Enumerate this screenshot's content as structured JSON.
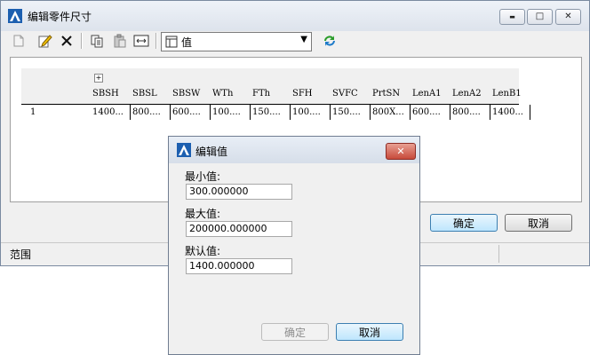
{
  "window": {
    "title": "编辑零件尺寸",
    "minimize_glyph": "▬",
    "maximize_glyph": "□",
    "close_glyph": "✕"
  },
  "toolbar": {
    "combo_value": "值"
  },
  "grid": {
    "expander": "+",
    "columns": [
      "SBSH",
      "SBSL",
      "SBSW",
      "WTh",
      "FTh",
      "SFH",
      "SVFC",
      "PrtSN",
      "LenA1",
      "LenA2",
      "LenB1"
    ],
    "rows": [
      {
        "index": "1",
        "cells": [
          "1400...",
          "800....",
          "600....",
          "100....",
          "150....",
          "100....",
          "150....",
          "800X...",
          "600....",
          "800....",
          "1400..."
        ]
      }
    ]
  },
  "buttons": {
    "ok": "确定",
    "cancel": "取消"
  },
  "status": {
    "text": "范围"
  },
  "dialog": {
    "title": "编辑值",
    "close_glyph": "✕",
    "min_label": "最小值:",
    "min_value": "300.000000",
    "max_label": "最大值:",
    "max_value": "200000.000000",
    "default_label": "默认值:",
    "default_value": "1400.000000",
    "ok": "确定",
    "cancel": "取消"
  },
  "colors": {
    "accent": "#3c7fb1",
    "close_red": "#c74b3b",
    "icon_blue": "#1c5fb0"
  }
}
